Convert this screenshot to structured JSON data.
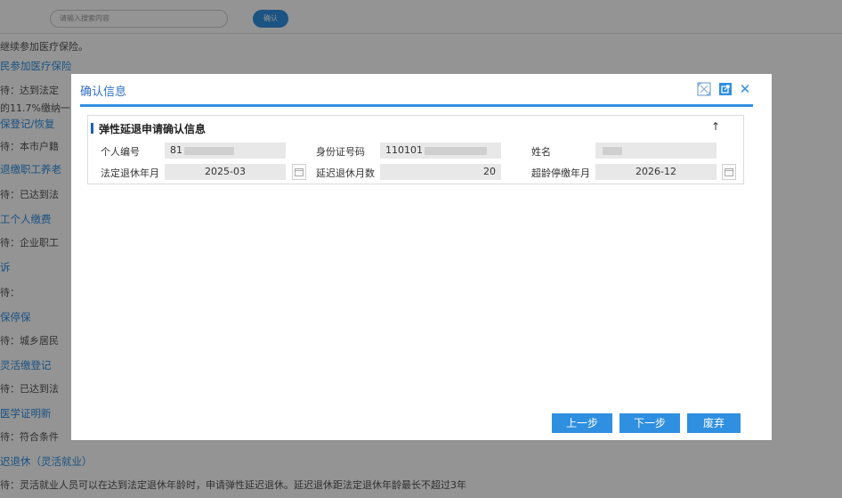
{
  "background": {
    "search_placeholder": "请输入搜索内容",
    "search_button": "确认",
    "lines": [
      {
        "text": "继续参加医疗保险。",
        "kind": "t"
      },
      {
        "text": "民参加医疗保险",
        "kind": "h"
      },
      {
        "text": "待：达到法定",
        "kind": "t"
      },
      {
        "text": "的11.7%缴纳一",
        "kind": "t"
      },
      {
        "text": "保登记/恢复",
        "kind": "h"
      },
      {
        "text": "待：本市户籍",
        "kind": "t"
      },
      {
        "text": "退缴职工养老",
        "kind": "h"
      },
      {
        "text": "待：已达到法",
        "kind": "t"
      },
      {
        "text": "工个人缴费",
        "kind": "h"
      },
      {
        "text": "待：企业职工",
        "kind": "t"
      },
      {
        "text": "诉",
        "kind": "h"
      },
      {
        "text": "待：",
        "kind": "t"
      },
      {
        "text": "保停保",
        "kind": "h"
      },
      {
        "text": "待：城乡居民",
        "kind": "t"
      },
      {
        "text": "灵活缴登记",
        "kind": "h"
      },
      {
        "text": "待：已达到法",
        "kind": "t"
      },
      {
        "text": "医学证明新",
        "kind": "h"
      },
      {
        "text": "待：符合条件",
        "kind": "t"
      },
      {
        "text": "迟退休（灵活就业）",
        "kind": "h"
      },
      {
        "text": "待：灵活就业人员可以在达到法定退休年龄时，申请弹性延迟退休。延迟退休距法定退休年龄最长不超过3年",
        "kind": "t"
      }
    ]
  },
  "modal": {
    "title": "确认信息",
    "panel_title": "弹性延退申请确认信息",
    "collapse_symbol": "↑",
    "fields": {
      "personal_id_label": "个人编号",
      "personal_id_value": "81",
      "id_card_label": "身份证号码",
      "id_card_value": "110101",
      "name_label": "姓名",
      "retire_label": "法定退休年月",
      "retire_value": "2025-03",
      "delay_label": "延迟退休月数",
      "delay_value": "20",
      "over_label": "超龄停缴年月",
      "over_value": "2026-12"
    },
    "buttons": {
      "prev": "上一步",
      "next": "下一步",
      "discard": "废弃"
    }
  },
  "colors": {
    "accent": "#2f8fe0",
    "title": "#2f6fc0"
  }
}
